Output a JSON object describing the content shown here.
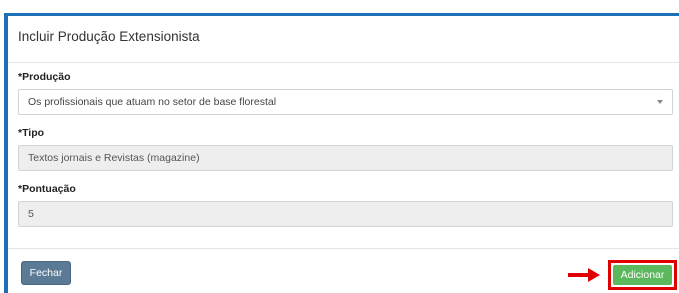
{
  "modal": {
    "title": "Incluir Produção Extensionista"
  },
  "fields": {
    "producao": {
      "label": "*Produção",
      "value": "Os profissionais que atuam no setor de base florestal"
    },
    "tipo": {
      "label": "*Tipo",
      "value": "Textos jornais e Revistas (magazine)"
    },
    "pontuacao": {
      "label": "*Pontuação",
      "value": "5"
    }
  },
  "buttons": {
    "close_label": "Fechar",
    "add_label": "Adicionar"
  },
  "colors": {
    "accent_border": "#1d6fb8",
    "close_button": "#5b7a96",
    "add_button": "#5cb85c",
    "highlight": "#e00000"
  },
  "icons": {
    "select_caret": "chevron-down-icon",
    "annotation_arrow": "arrow-right-icon"
  }
}
